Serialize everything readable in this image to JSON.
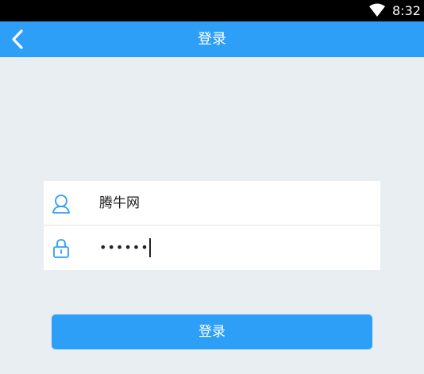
{
  "status_bar": {
    "time": "8:32",
    "wifi_icon": "wifi-icon"
  },
  "app_bar": {
    "title": "登录",
    "back_icon": "chevron-left-icon"
  },
  "form": {
    "username": {
      "icon": "user-icon",
      "value": "腾牛网"
    },
    "password": {
      "icon": "lock-icon",
      "value": "••••••"
    }
  },
  "login_button": {
    "label": "登录"
  },
  "colors": {
    "accent": "#2d9ff7",
    "background": "#e8eef2",
    "card": "#ffffff"
  }
}
